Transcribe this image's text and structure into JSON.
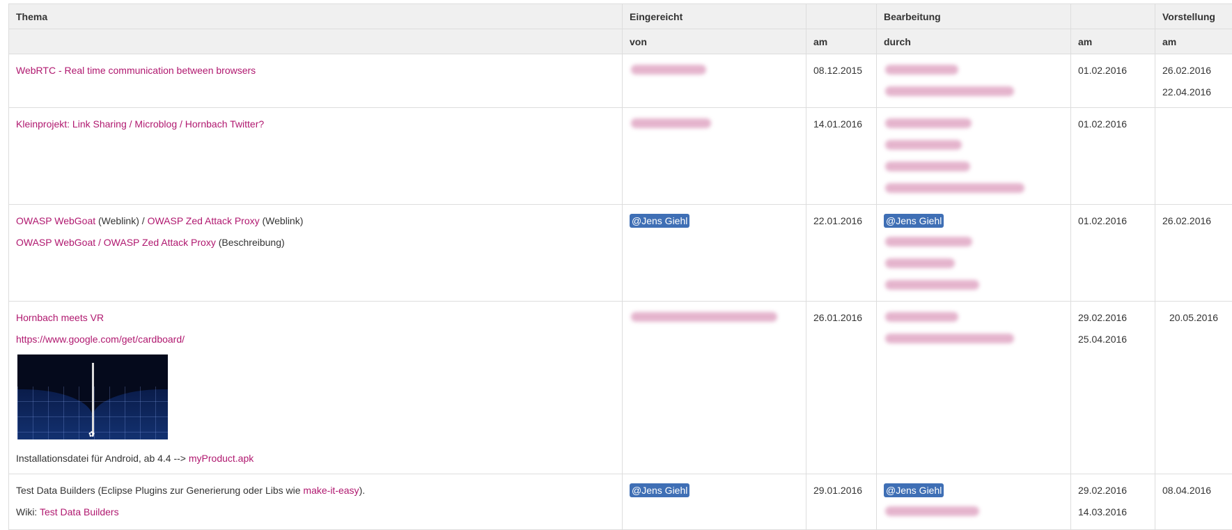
{
  "table": {
    "headers_top": [
      "Thema",
      "Eingereicht",
      "",
      "Bearbeitung",
      "",
      "Vorstellung"
    ],
    "headers_sub": [
      "",
      "von",
      "am",
      "durch",
      "am",
      "am"
    ],
    "rows": [
      {
        "thema_link": "WebRTC - Real time communication between browsers",
        "submitted_date": "08.12.2015",
        "processing_date": "01.02.2016",
        "presentation_dates": [
          "26.02.2016",
          "22.04.2016"
        ]
      },
      {
        "thema_link": "Kleinprojekt: Link Sharing / Microblog / Hornbach Twitter?",
        "submitted_date": "14.01.2016",
        "processing_date": "01.02.2016",
        "presentation_dates": []
      },
      {
        "line1": {
          "link1": "OWASP WebGoat",
          "text1": " (Weblink) / ",
          "link2": "OWASP Zed Attack Proxy",
          "text2": " (Weblink)"
        },
        "line2": {
          "link": "OWASP WebGoat / OWASP Zed Attack Proxy",
          "text": " (Beschreibung)"
        },
        "submitter": "@Jens Giehl",
        "submitted_date": "22.01.2016",
        "processor": "@Jens Giehl",
        "processing_date": "01.02.2016",
        "presentation_dates": [
          "26.02.2016"
        ]
      },
      {
        "thema_link": "Hornbach meets VR",
        "url": "https://www.google.com/get/cardboard/",
        "install_text": "Installationsdatei für Android, ab 4.4 --> ",
        "install_link": "myProduct.apk",
        "submitted_date": "26.01.2016",
        "processing_dates": [
          "29.02.2016",
          "25.04.2016"
        ],
        "presentation_dates": [
          "20.05.2016"
        ]
      },
      {
        "text1": "Test Data Builders (Eclipse Plugins zur Generierung oder Libs wie ",
        "link1": "make-it-easy",
        "text2": ").",
        "wiki_label": "Wiki: ",
        "wiki_link": "Test Data Builders",
        "submitter": "@Jens Giehl",
        "submitted_date": "29.01.2016",
        "processor": "@Jens Giehl",
        "processing_dates": [
          "29.02.2016",
          "14.03.2016"
        ],
        "presentation_dates": [
          "08.04.2016"
        ]
      }
    ]
  },
  "colors": {
    "link": "#b0186f",
    "mention_bg": "#3f6fb5",
    "header_bg": "#f0f0f0"
  }
}
